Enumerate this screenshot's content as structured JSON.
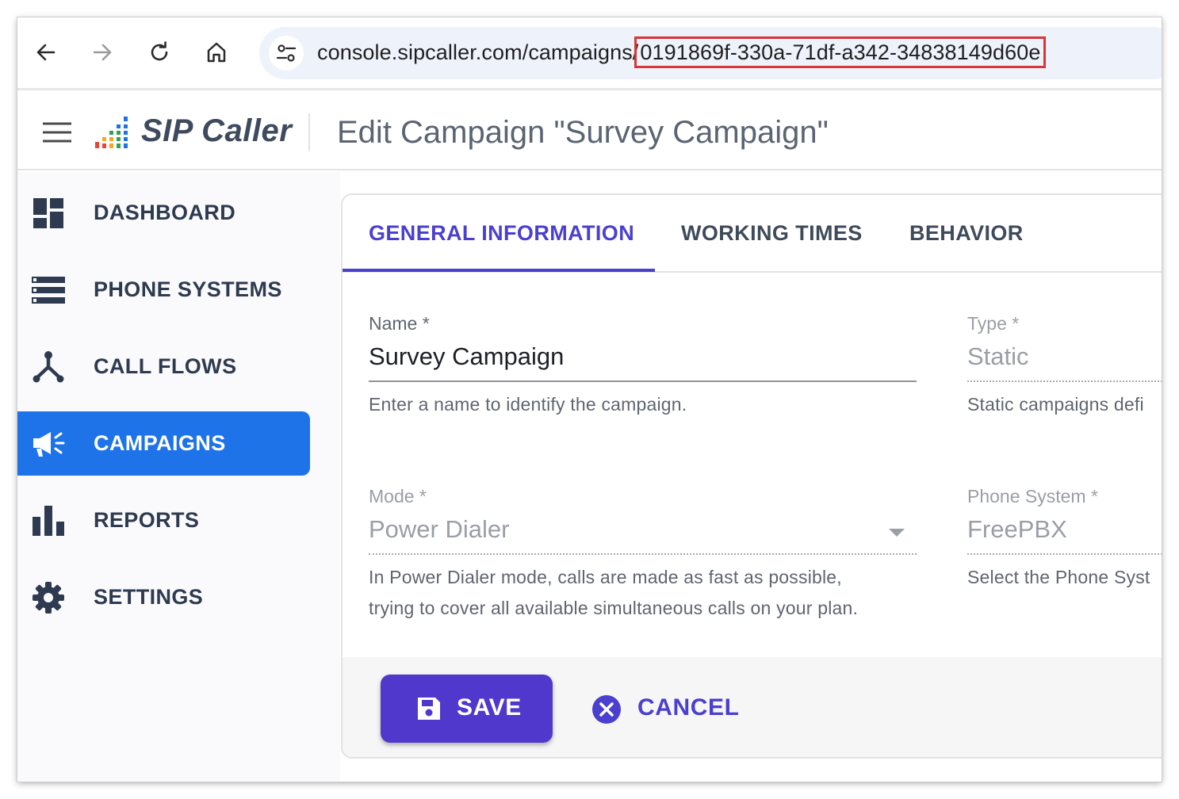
{
  "browser": {
    "url_base": "console.sipcaller.com/campaigns/",
    "url_id": "0191869f-330a-71df-a342-34838149d60e"
  },
  "header": {
    "logo_text": "SIP Caller",
    "page_title": "Edit Campaign \"Survey Campaign\""
  },
  "sidebar": {
    "items": [
      {
        "label": "DASHBOARD",
        "icon": "dashboard-icon",
        "active": false
      },
      {
        "label": "PHONE SYSTEMS",
        "icon": "list-icon",
        "active": false
      },
      {
        "label": "CALL FLOWS",
        "icon": "call-flows-icon",
        "active": false
      },
      {
        "label": "CAMPAIGNS",
        "icon": "megaphone-icon",
        "active": true
      },
      {
        "label": "REPORTS",
        "icon": "bar-chart-icon",
        "active": false
      },
      {
        "label": "SETTINGS",
        "icon": "gear-icon",
        "active": false
      }
    ]
  },
  "tabs": [
    {
      "label": "GENERAL INFORMATION",
      "active": true
    },
    {
      "label": "WORKING TIMES",
      "active": false
    },
    {
      "label": "BEHAVIOR",
      "active": false
    }
  ],
  "form": {
    "name": {
      "label": "Name *",
      "value": "Survey Campaign",
      "help": "Enter a name to identify the campaign."
    },
    "type": {
      "label": "Type *",
      "value": "Static",
      "help": "Static campaigns defi"
    },
    "mode": {
      "label": "Mode *",
      "value": "Power Dialer",
      "help_line1": "In Power Dialer mode, calls are made as fast as possible,",
      "help_line2": "trying to cover all available simultaneous calls on your plan."
    },
    "phone_system": {
      "label": "Phone System *",
      "value": "FreePBX",
      "help": "Select the Phone Syst"
    }
  },
  "actions": {
    "save_label": "SAVE",
    "cancel_label": "CANCEL"
  },
  "colors": {
    "primary": "#5138cc",
    "sidebar_active": "#1e73e8",
    "url_highlight": "#d93636"
  }
}
